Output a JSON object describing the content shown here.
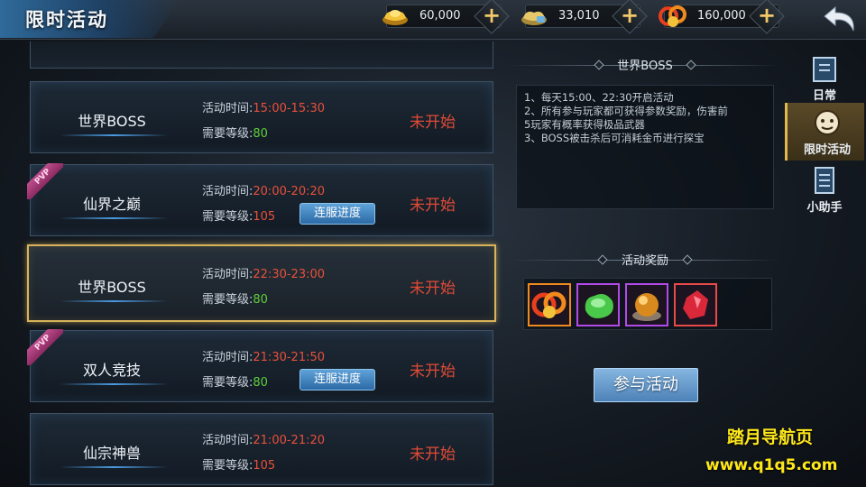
{
  "header": {
    "title": "限时活动",
    "currencies": [
      {
        "icon": "gold-ingot-icon",
        "value": "60,000"
      },
      {
        "icon": "silver-ingot-icon",
        "value": "33,010"
      },
      {
        "icon": "coin-pile-icon",
        "value": "160,000"
      }
    ],
    "add_symbol": "+",
    "back_icon": "back-arrow-icon"
  },
  "activities": [
    {
      "name": "世界BOSS",
      "time_label": "活动时间:",
      "time": "15:00-15:30",
      "level_label": "需要等级:",
      "level": "80",
      "level_color": "green",
      "status": "未开始",
      "pvp": false,
      "server_button": null
    },
    {
      "name": "仙界之巅",
      "time_label": "活动时间:",
      "time": "20:00-20:20",
      "level_label": "需要等级:",
      "level": "105",
      "level_color": "red",
      "status": "未开始",
      "pvp": true,
      "server_button": "连服进度"
    },
    {
      "name": "世界BOSS",
      "time_label": "活动时间:",
      "time": "22:30-23:00",
      "level_label": "需要等级:",
      "level": "80",
      "level_color": "green",
      "status": "未开始",
      "pvp": false,
      "server_button": null,
      "selected": true
    },
    {
      "name": "双人竞技",
      "time_label": "活动时间:",
      "time": "21:30-21:50",
      "level_label": "需要等级:",
      "level": "80",
      "level_color": "green",
      "status": "未开始",
      "pvp": true,
      "server_button": "连服进度"
    },
    {
      "name": "仙宗神兽",
      "time_label": "活动时间:",
      "time": "21:00-21:20",
      "level_label": "需要等级:",
      "level": "105",
      "level_color": "red",
      "status": "未开始",
      "pvp": false,
      "server_button": null
    }
  ],
  "pvp_tag": "PVP",
  "detail": {
    "title": "世界BOSS",
    "description": [
      "1、每天15:00、22:30开启活动",
      "2、所有参与玩家都可获得参数奖励，伤害前",
      "5玩家有概率获得极品武器",
      "3、BOSS被击杀后可消耗金币进行探宝"
    ],
    "rewards_title": "活动奖励",
    "rewards": [
      {
        "icon": "coin-pile-icon",
        "rarity_color": "#f08a1e"
      },
      {
        "icon": "jade-stone-icon",
        "rarity_color": "#b24ae8"
      },
      {
        "icon": "orb-icon",
        "rarity_color": "#b24ae8"
      },
      {
        "icon": "red-crystal-icon",
        "rarity_color": "#e84a4a"
      }
    ],
    "join_button": "参与活动"
  },
  "side_tabs": [
    {
      "label": "日常",
      "icon": "daily-scroll-icon",
      "active": false
    },
    {
      "label": "限时活动",
      "icon": "limited-event-icon",
      "active": true
    },
    {
      "label": "小助手",
      "icon": "helper-list-icon",
      "active": false
    }
  ],
  "watermark": {
    "line1": "踏月导航页",
    "line2": "www.q1q5.com"
  }
}
